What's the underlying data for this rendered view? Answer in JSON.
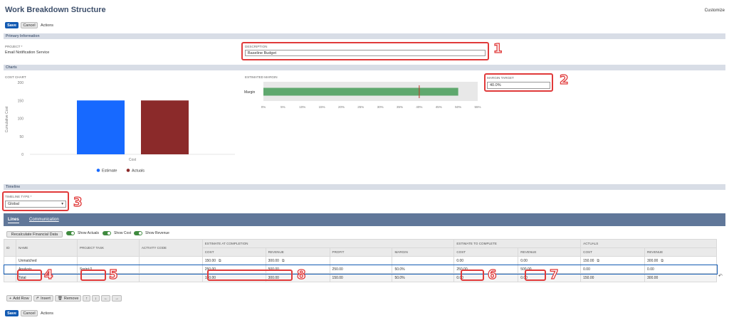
{
  "header": {
    "title": "Work Breakdown Structure",
    "customize": "Customize"
  },
  "toolbar": {
    "save": "Save",
    "cancel": "Cancel",
    "actions": "Actions"
  },
  "primary": {
    "section": "Primary Information",
    "project_label": "PROJECT *",
    "project_value": "Email Notification Service",
    "description_label": "DESCRIPTION",
    "description_value": "Baseline Budget"
  },
  "charts": {
    "section": "Charts",
    "cost_chart_label": "COST CHART",
    "estimated_margin_label": "ESTIMATED MARGIN",
    "margin_target_label": "MARGIN TARGET",
    "margin_target_value": "40.0%"
  },
  "chart_data": [
    {
      "type": "bar",
      "title": "COST CHART",
      "categories": [
        "Cost"
      ],
      "ylabel": "Cumulative Cost",
      "ylim": [
        0,
        200
      ],
      "yticks": [
        "200",
        "150",
        "100",
        "50",
        "0"
      ],
      "series": [
        {
          "name": "Estimate",
          "values": [
            150
          ],
          "color": "#1769ff"
        },
        {
          "name": "Actuals",
          "values": [
            150
          ],
          "color": "#8b2a2a"
        }
      ],
      "legend": "bottom"
    },
    {
      "type": "bar",
      "title": "ESTIMATED MARGIN",
      "categories": [
        "Margin"
      ],
      "values": [
        50
      ],
      "target": 40,
      "xlim": [
        0,
        55
      ],
      "xticks": [
        "0%",
        "5%",
        "10%",
        "15%",
        "20%",
        "25%",
        "30%",
        "35%",
        "40%",
        "45%",
        "50%",
        "55%"
      ],
      "color": "#5fa86e",
      "target_color": "#c0392b"
    }
  ],
  "timeline": {
    "section": "Timeline",
    "type_label": "TIMELINE TYPE *",
    "type_value": "Global"
  },
  "tabs": {
    "lines": "Lines",
    "communication": "Communication"
  },
  "lines_toolbar": {
    "recalc": "Recalculate Financial Data",
    "show_actuals": "Show Actuals",
    "show_cost": "Show Cost",
    "show_revenue": "Show Revenue"
  },
  "table": {
    "col_id": "ID",
    "col_name": "NAME",
    "col_task": "PROJECT TASK",
    "col_activity": "ACTIVITY CODE",
    "group_eac": "ESTIMATE AT COMPLETION",
    "group_etc": "ESTIMATE TO COMPLETE",
    "group_actuals": "ACTUALS",
    "sub": {
      "cost": "COST",
      "revenue": "REVENUE",
      "profit": "PROFIT",
      "margin": "MARGIN"
    },
    "rows": [
      {
        "name": "Unmatched",
        "task": "",
        "eac_cost": "150.00",
        "eac_rev": "300.00",
        "profit": "",
        "margin": "",
        "etc_cost": "0.00",
        "etc_rev": "0.00",
        "act_cost": "150.00",
        "act_rev": "300.00"
      },
      {
        "name": "Analysis",
        "task": "Sprint 0",
        "eac_cost": "250.00",
        "eac_rev": "500.00",
        "profit": "250.00",
        "margin": "50.0%",
        "etc_cost": "250.00",
        "etc_rev": "500.00",
        "act_cost": "0.00",
        "act_rev": "0.00"
      },
      {
        "name": "Total",
        "task": "",
        "eac_cost": "150.00",
        "eac_rev": "300.00",
        "profit": "150.00",
        "margin": "50.0%",
        "etc_cost": "0.00",
        "etc_rev": "0.00",
        "act_cost": "150.00",
        "act_rev": "300.00"
      }
    ]
  },
  "row_actions": {
    "add": "Add Row",
    "insert": "Insert",
    "remove": "Remove"
  },
  "annotations": [
    "1",
    "2",
    "3",
    "4",
    "5",
    "6",
    "7",
    "8"
  ],
  "colors": {
    "brand": "#125ab2",
    "tabbar": "#607799",
    "highlight": "#e03a3a"
  }
}
